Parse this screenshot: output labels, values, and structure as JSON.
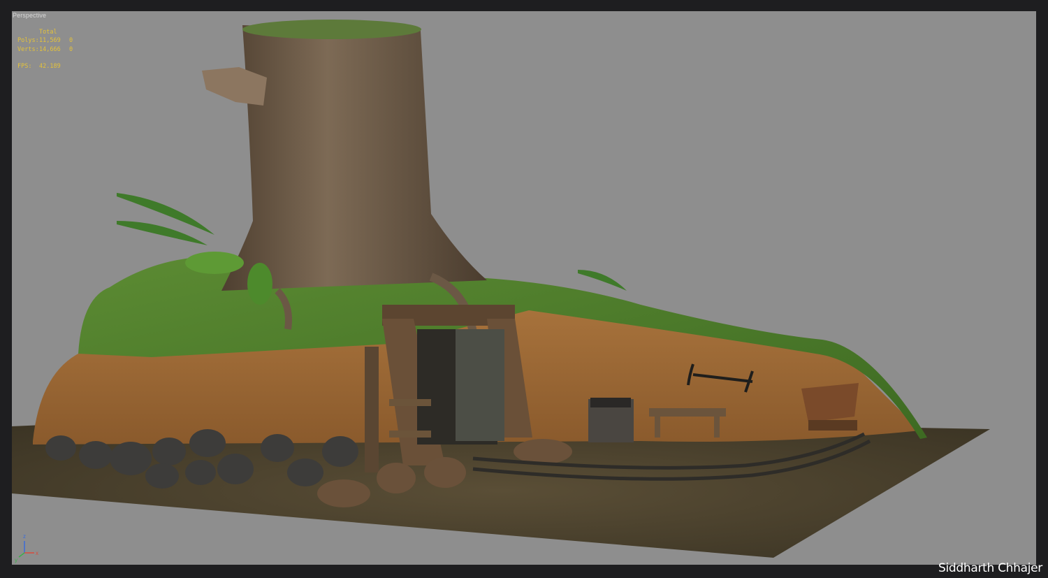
{
  "viewport": {
    "label": "Perspective",
    "stats": {
      "header": "Total",
      "rows": [
        {
          "label": "Polys:",
          "total": "11,569",
          "selected": "0"
        },
        {
          "label": "Verts:",
          "total": "14,666",
          "selected": "0"
        }
      ],
      "fps_label": "FPS:",
      "fps_value": "42.189"
    },
    "axis_gizmo": {
      "x": "x",
      "y": "y",
      "z": "z"
    }
  },
  "credit": "Siddharth Chhajer",
  "colors": {
    "frame": "#1e1e20",
    "viewport_bg": "#8e8e8e",
    "stats_text": "#e4c23a",
    "grass": "#4f7a2a",
    "soil": "#b27a3e",
    "bark": "#6e5a45",
    "ground": "#4a4230"
  },
  "scene_objects": [
    "tree-stump",
    "mine-entrance",
    "rail-track",
    "mine-cart",
    "pickaxe",
    "workbench",
    "stone-basket",
    "boulder-row",
    "ferns",
    "roots"
  ]
}
